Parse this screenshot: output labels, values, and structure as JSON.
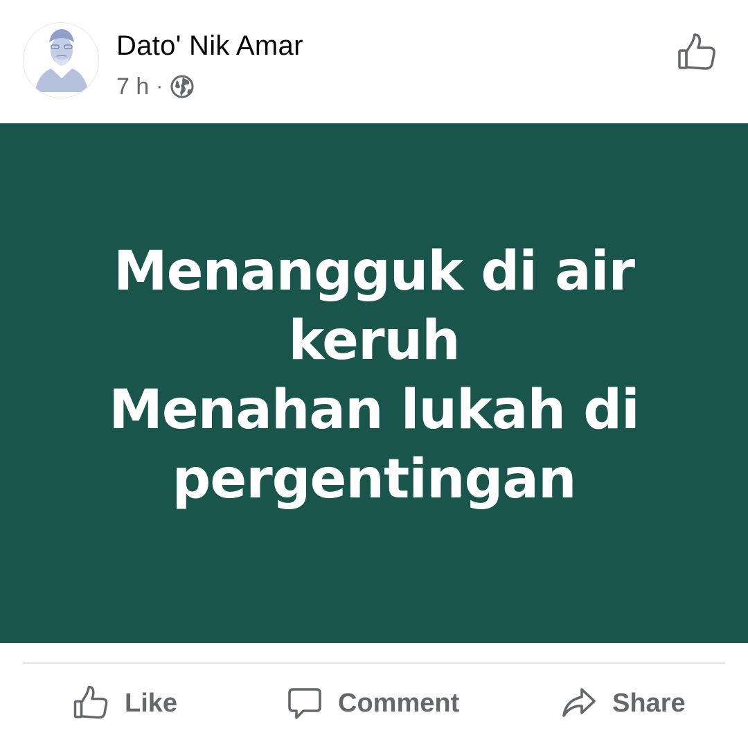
{
  "post": {
    "author_name": "Dato' Nik Amar",
    "timestamp": "7 h",
    "separator": "·",
    "privacy_icon": "globe-icon",
    "card_lines": [
      "Menangguk di air",
      "keruh",
      "Menahan lukah di",
      "pergentingan"
    ],
    "card_background": "#1a554b",
    "card_text_color": "#ffffff"
  },
  "actions": {
    "like_label": "Like",
    "comment_label": "Comment",
    "share_label": "Share",
    "icons": [
      "thumbs-up-icon",
      "speech-bubble-icon",
      "share-arrow-icon"
    ],
    "color": "#65676b"
  }
}
